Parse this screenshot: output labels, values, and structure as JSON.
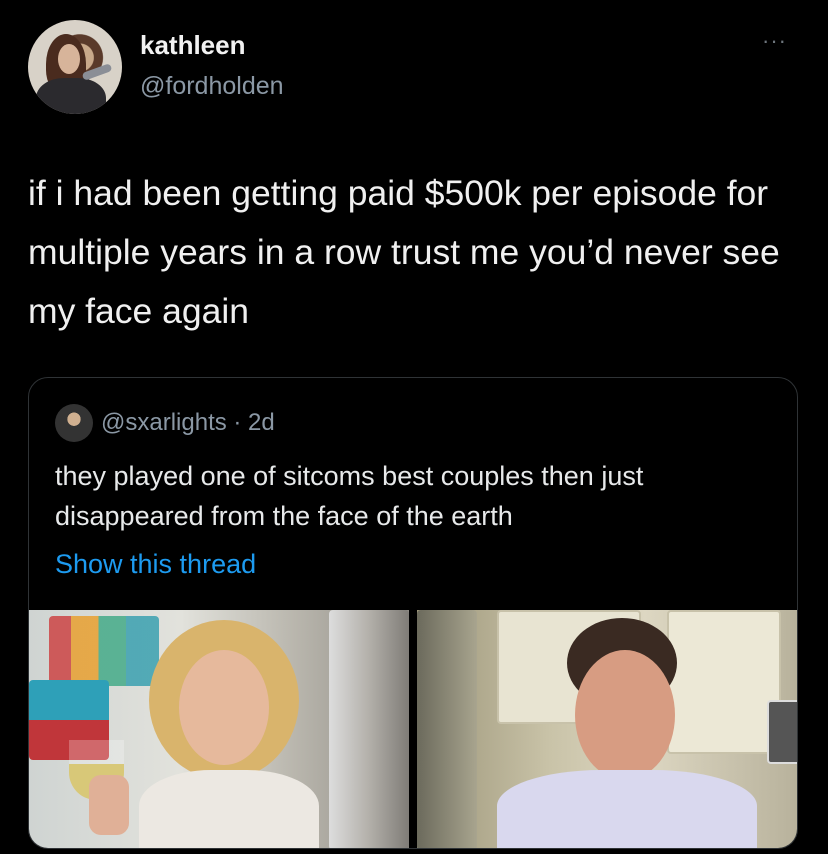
{
  "tweet": {
    "display_name": "kathleen",
    "handle": "@fordholden",
    "more_label": "···",
    "text": "if i had been getting paid $500k per episode for multiple years in a row trust me you’d never see my face again"
  },
  "quoted": {
    "handle_time": "@sxarlights · 2d",
    "text": "they played one of sitcoms best couples then just disappeared from the face of the earth",
    "show_thread": "Show this thread"
  },
  "images": {
    "left_icon": "photo-woman-holding-wine-glass",
    "right_icon": "photo-man-smiling-kitchen"
  },
  "colors": {
    "background": "#000000",
    "link": "#1d9bf0",
    "secondary_text": "#8b98a5"
  }
}
